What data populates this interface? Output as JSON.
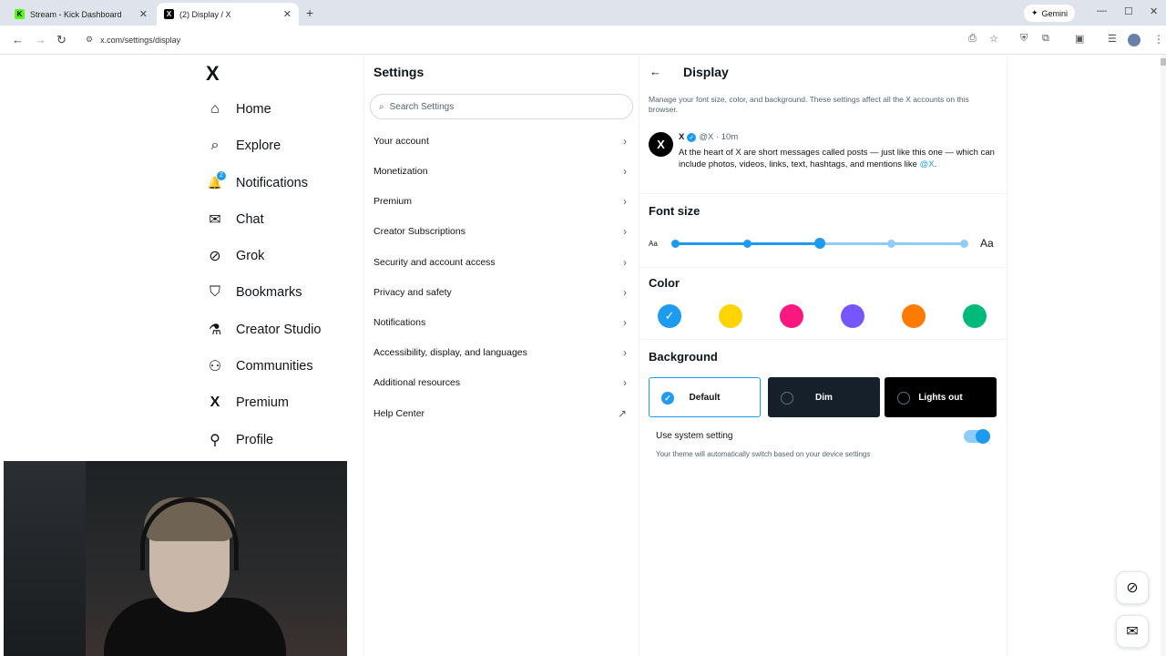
{
  "browser": {
    "tabs": [
      {
        "title": "Stream - Kick Dashboard",
        "favicon": "K"
      },
      {
        "title": "(2) Display / X",
        "favicon": "X"
      }
    ],
    "new_tab": "+",
    "gemini_label": "Gemini",
    "url": "x.com/settings/display"
  },
  "leftnav": {
    "logo": "X",
    "items": [
      {
        "label": "Home",
        "icon": "⌂"
      },
      {
        "label": "Explore",
        "icon": "⌕"
      },
      {
        "label": "Notifications",
        "icon": "🔔",
        "badge": "2"
      },
      {
        "label": "Chat",
        "icon": "✉"
      },
      {
        "label": "Grok",
        "icon": "⊘"
      },
      {
        "label": "Bookmarks",
        "icon": "⛉"
      },
      {
        "label": "Creator Studio",
        "icon": "⚗"
      },
      {
        "label": "Communities",
        "icon": "⚇"
      },
      {
        "label": "Premium",
        "icon": "X"
      },
      {
        "label": "Profile",
        "icon": "⚲"
      }
    ]
  },
  "settings": {
    "title": "Settings",
    "search_placeholder": "Search Settings",
    "items": [
      {
        "label": "Your account",
        "chev": "›"
      },
      {
        "label": "Monetization",
        "chev": "›"
      },
      {
        "label": "Premium",
        "chev": "›"
      },
      {
        "label": "Creator Subscriptions",
        "chev": "›"
      },
      {
        "label": "Security and account access",
        "chev": "›"
      },
      {
        "label": "Privacy and safety",
        "chev": "›"
      },
      {
        "label": "Notifications",
        "chev": "›"
      },
      {
        "label": "Accessibility, display, and languages",
        "chev": "›"
      },
      {
        "label": "Additional resources",
        "chev": "›"
      },
      {
        "label": "Help Center",
        "chev": "↗"
      }
    ]
  },
  "display": {
    "back": "←",
    "title": "Display",
    "description": "Manage your font size, color, and background. These settings affect all the X accounts on this browser.",
    "sample_post": {
      "avatar": "X",
      "name": "X",
      "handle_time": "@X · 10m",
      "body": "At the heart of X are short messages called posts — just like this one — which can include photos, videos, links, text, hashtags, and mentions like",
      "mention": "@X",
      "end": "."
    },
    "font_size": {
      "title": "Font size",
      "small_label": "Aa",
      "large_label": "Aa",
      "steps": 5,
      "selected_step": 3
    },
    "color": {
      "title": "Color",
      "swatches": [
        "#1d9bf0",
        "#ffd400",
        "#f91880",
        "#7856ff",
        "#ff7a00",
        "#00ba7c"
      ],
      "selected": 0
    },
    "background": {
      "title": "Background",
      "options": [
        {
          "label": "Default",
          "bg": "#ffffff",
          "fg": "#0f1419",
          "selected": true
        },
        {
          "label": "Dim",
          "bg": "#15202b",
          "fg": "#ffffff",
          "selected": false
        },
        {
          "label": "Lights out",
          "bg": "#000000",
          "fg": "#ffffff",
          "selected": false
        }
      ],
      "system_label": "Use system setting",
      "system_sub": "Your theme will automatically switch based on your device settings",
      "system_on": true
    }
  },
  "floating": {
    "grok_icon": "grok-icon",
    "mail_icon": "mail-icon"
  }
}
